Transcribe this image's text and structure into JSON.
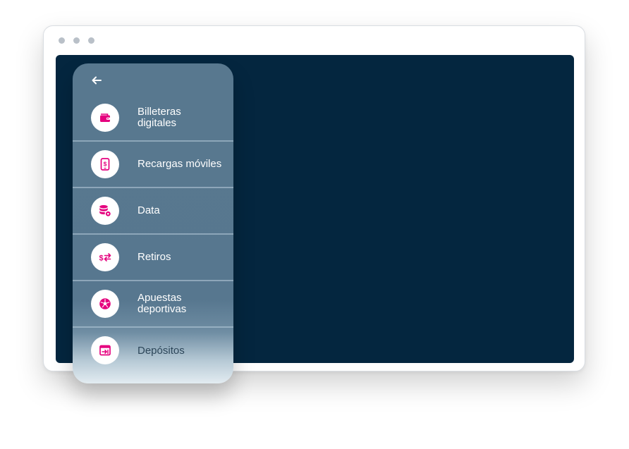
{
  "window": {
    "accent": "#e5007e",
    "screen_color": "#04263f",
    "panel_color": "#58788f"
  },
  "menu": {
    "back_icon": "arrow-left-icon",
    "items": [
      {
        "label": "Billeteras digitales",
        "icon": "wallet-icon"
      },
      {
        "label": "Recargas móviles",
        "icon": "mobile-dollar-icon"
      },
      {
        "label": "Data",
        "icon": "database-gear-icon"
      },
      {
        "label": "Retiros",
        "icon": "dollar-exchange-icon"
      },
      {
        "label": "Apuestas deportivas",
        "icon": "soccer-ball-icon"
      },
      {
        "label": "Depósitos",
        "icon": "deposit-window-icon"
      }
    ]
  }
}
